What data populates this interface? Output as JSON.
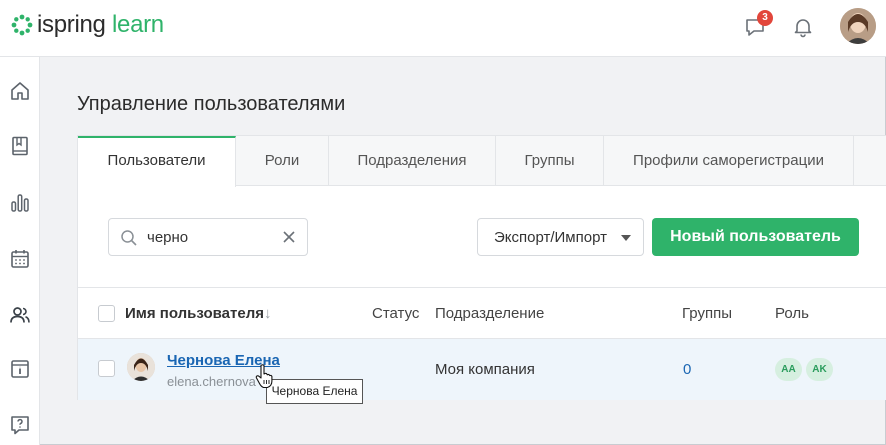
{
  "app": {
    "logo_part1": "ispring",
    "logo_part2": "learn",
    "messages_badge": "3"
  },
  "sidebar": {
    "items": [
      "home-icon",
      "book-icon",
      "chart-icon",
      "calendar-icon",
      "users-icon",
      "info-icon",
      "help-icon"
    ],
    "active": "users-icon"
  },
  "page": {
    "title": "Управление пользователями"
  },
  "tabs": [
    {
      "label": "Пользователи",
      "active": true
    },
    {
      "label": "Роли"
    },
    {
      "label": "Подразделения"
    },
    {
      "label": "Группы"
    },
    {
      "label": "Профили саморегистрации"
    }
  ],
  "toolbar": {
    "search_value": "черно",
    "export_label": "Экспорт/Импорт",
    "new_user_label": "Новый пользователь"
  },
  "table": {
    "columns": [
      "Имя пользователя",
      "Статус",
      "Подразделение",
      "Группы",
      "Роль"
    ],
    "sort_indicator": "↓",
    "rows": [
      {
        "name": "Чернова Елена",
        "email": "elena.chernova",
        "status": "",
        "department": "Моя компания",
        "groups": "0",
        "roles": [
          "AA",
          "AK"
        ]
      }
    ]
  },
  "tooltip": {
    "text": "Чернова Елена"
  },
  "colors": {
    "accent": "#2fb36a",
    "link": "#1a66b3",
    "badge": "#e2463b"
  }
}
